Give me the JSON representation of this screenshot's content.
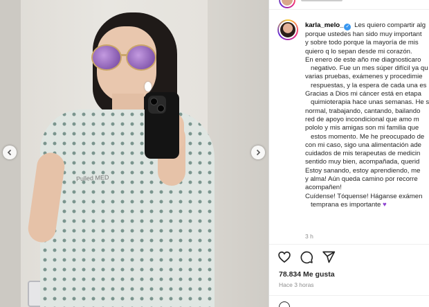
{
  "post": {
    "username": "karla_melo_",
    "caption_lines": [
      "Les quiero compartir alg",
      "porque ustedes han sido muy important",
      "y sobre todo porque la mayoría de mis",
      "quiero q lo sepan desde mi corazón.",
      "En enero de este año me diagnosticaro",
      "negativo. Fue un mes súper difícil ya qu",
      "varias pruebas, exámenes y procedimie",
      "respuestas, y la espera de cada una es",
      "Gracias a Dios mi cáncer está en etapa",
      "quimioterapia hace unas semanas. He s",
      "normal, trabajando, cantando, bailando",
      "red de apoyo incondicional que amo m",
      "pololo y mis amigas son mi familia que",
      "estos momento. Me he preocupado de",
      "con mi caso, sigo una alimentación ade",
      "cuidados de mis terapeutas de medicin",
      "sentido muy bien, acompañada, querid",
      "Estoy sanando, estoy aprendiendo, me",
      "y alma! Aún queda camino por recorre",
      "acompañen!",
      "Cuídense! Tóquense! Háganse exámen",
      "temprana es importante"
    ],
    "caption_time": "3 h",
    "likes": "78.834 Me gusta",
    "posted": "Hace 3 horas",
    "photo_watermark": "Pulled MED",
    "icons": {
      "verified": "verified-badge-icon",
      "like": "heart-icon",
      "comment": "comment-icon",
      "share": "send-icon",
      "prev": "chevron-left-icon",
      "next": "chevron-right-icon",
      "caption_end": "purple-heart-emoji",
      "emoji": "emoji-icon"
    },
    "colors": {
      "verified": "#3897f0",
      "heart_emoji": "#8e44d1",
      "secondary_text": "#8e8e8e"
    }
  }
}
